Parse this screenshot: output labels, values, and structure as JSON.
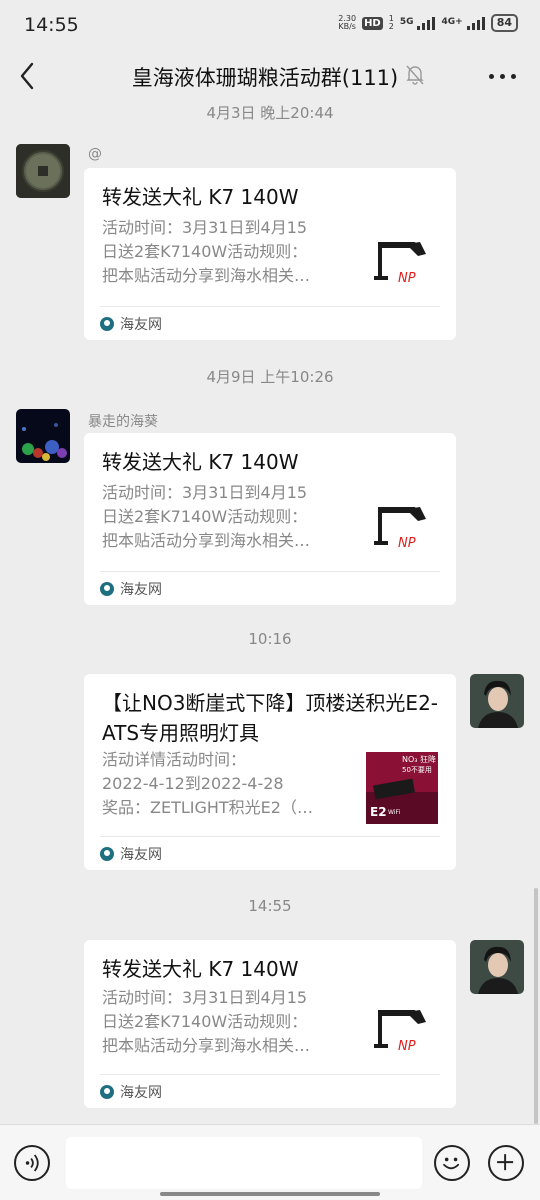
{
  "status": {
    "time": "14:55",
    "net_speed_value": "2.30",
    "net_speed_unit": "KB/s",
    "hd_label": "HD",
    "hd_sub": "1",
    "hd_sub2": "2",
    "sig1_label": "5G",
    "sig2_label": "4G+",
    "battery": "84"
  },
  "header": {
    "title": "皇海液体珊瑚粮活动群(111)",
    "back_icon": "back-arrow-icon",
    "mute_icon": "bell-muted-icon",
    "more_icon": "more-dots-icon"
  },
  "messages": [
    {
      "timestamp": "4月3日 晚上20:44",
      "sender": "@",
      "side": "left",
      "title": "转发送大礼 K7 140W",
      "desc": [
        "活动时间：3月31日到4月15",
        "日送2套K7140W活动规则：",
        "把本贴活动分享到海水相关…"
      ],
      "source": "海友网",
      "thumb_mark": "NP"
    },
    {
      "timestamp": "4月9日 上午10:26",
      "sender": "暴走的海葵",
      "side": "left",
      "title": "转发送大礼 K7 140W",
      "desc": [
        "活动时间：3月31日到4月15",
        "日送2套K7140W活动规则：",
        "把本贴活动分享到海水相关…"
      ],
      "source": "海友网",
      "thumb_mark": "NP"
    },
    {
      "timestamp": "10:16",
      "side": "right",
      "title": "【让NO3断崖式下降】顶楼送积光E2-ATS专用照明灯具",
      "desc": [
        "活动详情活动时间：",
        "2022-4-12到2022-4-28",
        "奖品：ZETLIGHT积光E2（…"
      ],
      "source": "海友网",
      "thumb_text_top": "NO₃ 狂降",
      "thumb_text_sub": "50不要用",
      "thumb_brand": "E2",
      "thumb_brand_sub": "WiFi"
    },
    {
      "timestamp": "14:55",
      "side": "right",
      "title": "转发送大礼 K7 140W",
      "desc": [
        "活动时间：3月31日到4月15",
        "日送2套K7140W活动规则：",
        "把本贴活动分享到海水相关…"
      ],
      "source": "海友网",
      "thumb_mark": "NP"
    }
  ],
  "input": {
    "voice_icon": "voice-icon",
    "emoji_icon": "emoji-icon",
    "plus_icon": "plus-icon"
  },
  "colors": {
    "background": "#ededed",
    "bubble": "#ffffff",
    "timestamp": "#888888",
    "source_logo": "#1e6f7f"
  }
}
